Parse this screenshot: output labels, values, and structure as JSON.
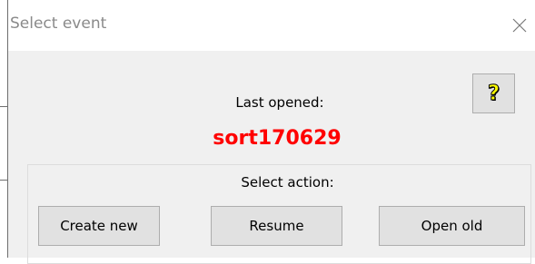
{
  "window": {
    "title": "Select event"
  },
  "icons": {
    "close": "close-icon",
    "help": "help-icon"
  },
  "help_button": {
    "label": "?"
  },
  "last_opened": {
    "label": "Last opened:",
    "value": "sort170629"
  },
  "actions": {
    "label": "Select action:",
    "buttons": [
      {
        "label": "Create new"
      },
      {
        "label": "Resume"
      },
      {
        "label": "Open old"
      }
    ]
  },
  "colors": {
    "event_name": "#ff0000",
    "help_glyph": "#ffff00",
    "button_face": "#e1e1e1",
    "window_bg": "#f0f0f0"
  }
}
